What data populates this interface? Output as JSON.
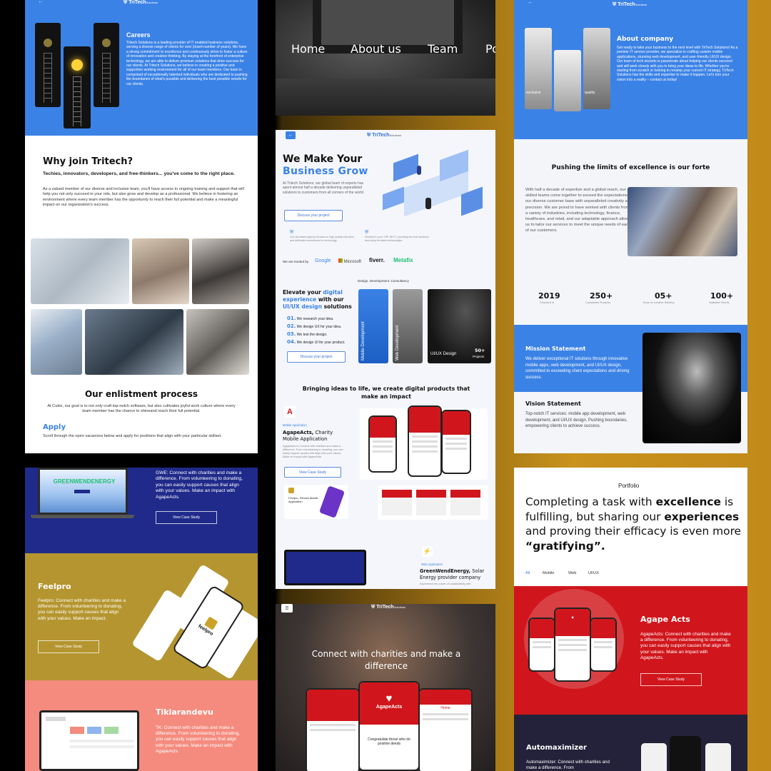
{
  "brand": "TriTech",
  "brand_suffix": "Solutions",
  "careers": {
    "title": "Careers",
    "body": "Tritech Solutions is a leading provider of IT enabled business solutions, serving a diverse range of clients for over (insert number of years). We have a strong commitment to excellence and continuously strive to foster a culture of innovation and creative thinking. By staying at the forefront of enterprise technology, we are able to deliver premium solutions that drive success for our clients. At Tritech Solutions, we believe in creating a positive and supportive working environment for all of our team members. Our team is comprised of exceptionally talented individuals who are dedicated to pushing the boundaries of what's possible and delivering the best possible results for our clients.",
    "why_title": "Why join Tritech?",
    "why_sub": "Techies, innovators, developers, and free-thinkers... you've come to the right place.",
    "why_body": "As a valued member of our diverse and inclusive team, you'll have access to ongoing training and support that will help you not only succeed in your role, but also grow and develop as a professional. We believe in fostering an environment where every team member has the opportunity to reach their full potential and make a meaningful impact on our organization's success.",
    "enlist_title": "Our enlistment process",
    "enlist_body": "At Cubix, our goal is to not only craft top-notch software, but also cultivates joyful work culture where every team member has the chance to shineand reach their full potential.",
    "apply_title": "Apply",
    "apply_body": "Scroll through the open vacancies below and apply for positions that align with your particular skillset."
  },
  "nav": {
    "items": [
      "Home",
      "About us",
      "Team",
      "Po"
    ]
  },
  "about": {
    "title": "About company",
    "body": "Get ready to take your business to the next level with TriTech Solutions! As a premier IT service provider, we specialize in crafting custom mobile applications, stunning web development, and user-friendly UI/UX design. Our team of tech wizards is passionate about helping our clients succeed and will work closely with you to bring your ideas to life. Whether you're starting from scratch or looking to revamp your current IT strategy, TriTech Solutions has the skills and expertise to make it happen. Let's turn your vision into a reality – contact us today!",
    "photo_labels": [
      "exclusive",
      "quality"
    ],
    "forte_title": "Pushing the limits of excellence is our forte",
    "forte_body": "With half a decade of expertise and a global reach, our skilled teams come together to exceed the expectations of our diverse customer base with unparalleled creativity and precision. We are proud to have worked with clients from a variety of industries, including technology, finance, healthcare, and retail, and our adaptable approach allows us to tailor our services to meet the unique needs of each of our customers.",
    "stats": [
      {
        "value": "2019",
        "label": "Founded in"
      },
      {
        "value": "250+",
        "label": "Completed Projects"
      },
      {
        "value": "05+",
        "label": "Years of creative thinking"
      },
      {
        "value": "100+",
        "label": "Satisfied Clients"
      }
    ],
    "mission_title": "Mission Statement",
    "mission_body": "We deliver exceptional IT solutions through innovative mobile apps, web development, and UI/UX design, committed to exceeding client expectations and driving success.",
    "vision_title": "Vision Statement",
    "vision_body": "Top-notch IT services: mobile app development, web development, and UI/UX design. Pushing boundaries, empowering clients to achieve success."
  },
  "home": {
    "hero_line1": "We Make Your",
    "hero_line2": "Business Grow",
    "hero_body": "At Tritech Solutions, our global team of experts has spent almost half a decade delivering unparalleled solutions to customers from all corners of the world.",
    "discuss_btn": "Discuss your project",
    "feat1": "Our city-based agency focuses on high quality execution and dedicated commitment to technology.",
    "feat2": "Devoted to pure THE NECT, providing the best solutions and using the latest technologies.",
    "trusted": "We are trusted by",
    "clients": [
      "Google",
      "Microsoft",
      "fiverr.",
      "Metafix"
    ],
    "ddc": "Design. Development. Consultancy",
    "elevate1": "Elevate your ",
    "elevate_hl1": "digital experience",
    "elevate2": " with our ",
    "elevate_hl2": "UI/UX design",
    "elevate3": " solutions",
    "steps": [
      {
        "n": "01.",
        "t": "We research your idea."
      },
      {
        "n": "02.",
        "t": "We design UX for your idea."
      },
      {
        "n": "03.",
        "t": "We test the design."
      },
      {
        "n": "04.",
        "t": "We design UI for your product."
      }
    ],
    "cards": [
      "Mobile Development",
      "Web Development",
      "UI/UX Design"
    ],
    "projects_count": "50+",
    "projects_label": "Projects",
    "bringing": "Bringing ideas to life, we create digital products that make an impact",
    "mobile_app": "Mobile Application",
    "agape_title": "AgapeActs,",
    "agape_title2": " Charity Mobile Application",
    "agape_body": "AgapeActs is Connect with charities and make a difference. From volunteering to donating, you can easily support causes that align with your values. Make an impact with AgapeActs.",
    "case_study_btn": "View Case Study",
    "feelpro_mini": "Feelpro, Fitness Mobile Application",
    "web_app": "Web Application",
    "gwe_title": "GreenWendEnergy,",
    "gwe_title2": " Solar Energy provider company",
    "gwe_body": "Experience the power of sustainability with"
  },
  "connect": {
    "title": "Connect with charities and make a difference",
    "app_name": "AgapeActs",
    "card_text": "Congratulate those who do positive deeds",
    "tab": "Home"
  },
  "works": {
    "gwe_logo": "GREENWENDENERGY",
    "gwe_body": "GWE: Connect with charities and make a difference. From volunteering to donating, you can easily support causes that align with your values. Make an impact with AgapeActs.",
    "case_btn": "View Case Study",
    "feelpro_title": "Feelpro",
    "feelpro_body": "Feelpro: Connect with charities and make a difference. From volunteering to donating, you can easily support causes that align with your values. Make an impact.",
    "feelpro_logo": "feelpro",
    "tik_title": "Tiklarandevu",
    "tik_body": "TK: Connect with charities and make a difference. From volunteering to donating, you can easily support causes that align with your values. Make an impact with AgapeActs."
  },
  "portfolio": {
    "label": "Portfolio",
    "h1": "Completing a task with ",
    "h1b": "excellence",
    "h2": " is fulfilling, but sharing our ",
    "h2b": "experiences",
    "h3": " and proving their efficacy is even more ",
    "h3b": "“gratifying”.",
    "filters": [
      "All",
      "Mobile",
      "Web",
      "UI/UX"
    ],
    "agape_title": "Agape Acts",
    "agape_body": "AgapeActs: Connect with charities and make a difference. From volunteering to donating, you can easily support causes that align with your values. Make an impact with AgapeActs.",
    "case_btn": "View Case Study",
    "auto_title": "Automaximizer",
    "auto_body": "Automaximizer: Connect with charities and make a difference. From"
  },
  "colors": {
    "blue": "#3b82e6",
    "red": "#d0161c",
    "navy": "#1f2a8a",
    "mustard": "#b5952f",
    "salmon": "#f48b7e",
    "gold": "#c28a1a"
  }
}
